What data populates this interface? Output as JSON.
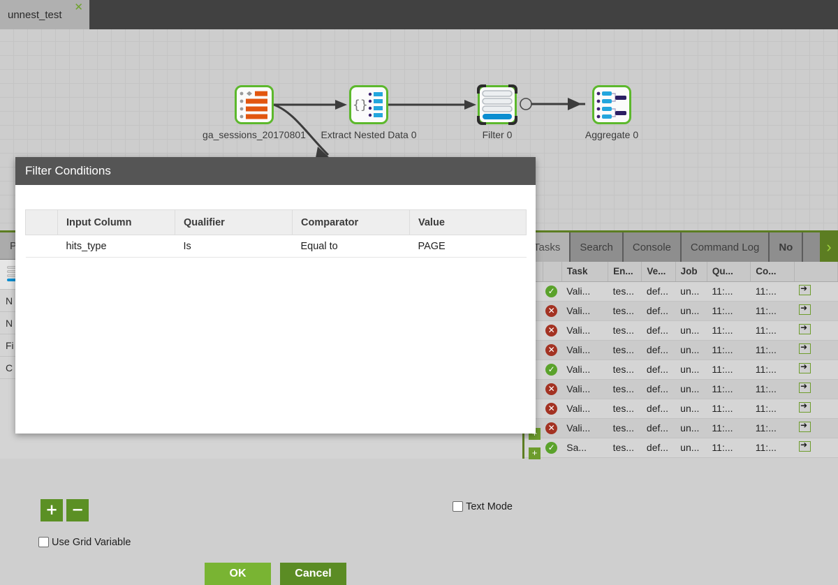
{
  "window": {
    "tab": {
      "label": "unnest_test",
      "close_icon": "close-icon"
    }
  },
  "canvas": {
    "nodes": [
      {
        "id": "source",
        "label": "ga_sessions_20170801",
        "icon": "table-input-icon",
        "selected": false
      },
      {
        "id": "extract",
        "label": "Extract Nested Data 0",
        "icon": "json-extract-icon",
        "selected": false
      },
      {
        "id": "filter",
        "label": "Filter 0",
        "icon": "filter-icon",
        "selected": true
      },
      {
        "id": "aggregate",
        "label": "Aggregate 0",
        "icon": "aggregate-icon",
        "selected": false
      }
    ],
    "colors": {
      "node_border": "#5cb82c",
      "connector": "#3c3c3c",
      "grid": "#c4c4c4"
    }
  },
  "properties_panel": {
    "tab_label": "P",
    "rows": [
      "N",
      "N",
      "Fi",
      "C"
    ]
  },
  "task_panel": {
    "tabs": [
      {
        "label": "Tasks",
        "active": true
      },
      {
        "label": "Search",
        "active": false
      },
      {
        "label": "Console",
        "active": false
      },
      {
        "label": "Command Log",
        "active": false
      },
      {
        "label": "No",
        "active": false,
        "partial": true
      }
    ],
    "scroll_right_icon": "chevron-right-icon",
    "columns": [
      "",
      "Task",
      "En...",
      "Ve...",
      "Job",
      "Qu...",
      "Co...",
      ""
    ],
    "rows": [
      {
        "status": "ok",
        "cells": [
          "Vali...",
          "tes...",
          "def...",
          "un...",
          "11:...",
          "11:..."
        ]
      },
      {
        "status": "err",
        "cells": [
          "Vali...",
          "tes...",
          "def...",
          "un...",
          "11:...",
          "11:..."
        ]
      },
      {
        "status": "err",
        "cells": [
          "Vali...",
          "tes...",
          "def...",
          "un...",
          "11:...",
          "11:..."
        ]
      },
      {
        "status": "err",
        "cells": [
          "Vali...",
          "tes...",
          "def...",
          "un...",
          "11:...",
          "11:..."
        ]
      },
      {
        "status": "ok",
        "cells": [
          "Vali...",
          "tes...",
          "def...",
          "un...",
          "11:...",
          "11:..."
        ]
      },
      {
        "status": "err",
        "cells": [
          "Vali...",
          "tes...",
          "def...",
          "un...",
          "11:...",
          "11:..."
        ]
      },
      {
        "status": "err",
        "cells": [
          "Vali...",
          "tes...",
          "def...",
          "un...",
          "11:...",
          "11:..."
        ]
      },
      {
        "status": "err",
        "cells": [
          "Vali...",
          "tes...",
          "def...",
          "un...",
          "11:...",
          "11:..."
        ]
      },
      {
        "status": "ok",
        "cells": [
          "Sa...",
          "tes...",
          "def...",
          "un...",
          "11:...",
          "11:..."
        ]
      }
    ]
  },
  "dialog": {
    "title": "Filter Conditions",
    "table": {
      "columns": [
        "",
        "Input Column",
        "Qualifier",
        "Comparator",
        "Value"
      ],
      "rows": [
        {
          "input_column": "hits_type",
          "qualifier": "Is",
          "comparator": "Equal to",
          "value": "PAGE"
        }
      ]
    },
    "add_label": "+",
    "remove_label": "−",
    "text_mode_label": "Text Mode",
    "text_mode_checked": false,
    "use_grid_variable_label": "Use Grid Variable",
    "use_grid_variable_checked": false,
    "ok_label": "OK",
    "cancel_label": "Cancel",
    "colors": {
      "titlebar": "#555555",
      "ok": "#79b433",
      "cancel": "#5b8c24",
      "small_button": "#5b9024"
    }
  }
}
